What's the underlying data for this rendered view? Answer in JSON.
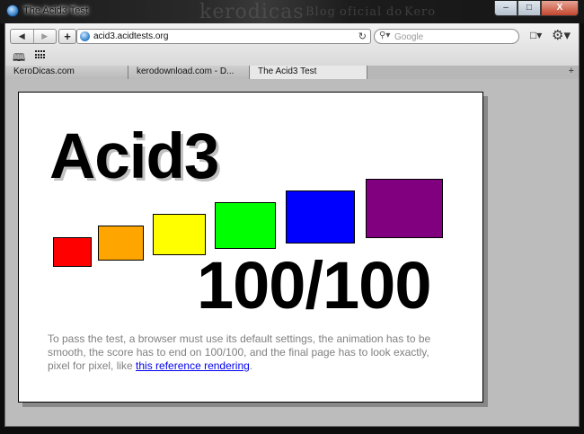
{
  "window": {
    "title": "The Acid3 Test",
    "background_words": [
      "ke",
      "rodicas",
      "Blog",
      "oficial",
      "do",
      "Kero"
    ],
    "minimize": "‒",
    "maximize": "□",
    "close": "X"
  },
  "toolbar": {
    "back": "◀",
    "forward": "▶",
    "add": "+",
    "url": "acid3.acidtests.org",
    "reload": "↻",
    "search_placeholder": "Google",
    "search_icon": "⚲▾",
    "page_menu": "□▾",
    "settings_menu": "⚙▾",
    "bookmarks_icon": "🕮"
  },
  "tabs": [
    {
      "label": "KeroDicas.com",
      "active": false
    },
    {
      "label": "kerodownload.com - D...",
      "active": false
    },
    {
      "label": "The Acid3 Test",
      "active": true
    }
  ],
  "new_tab": "+",
  "acid3": {
    "title": "Acid3",
    "score": "100/100",
    "boxes": [
      "#ff0000",
      "#ffa500",
      "#ffff00",
      "#00ff00",
      "#0000ff",
      "#800080"
    ],
    "description_pre": "To pass the test, a browser must use its default settings, the animation has to be smooth, the score has to end on 100/100, and the final page has to look exactly, pixel for pixel, like ",
    "reference_link": "this reference rendering",
    "description_post": "."
  }
}
